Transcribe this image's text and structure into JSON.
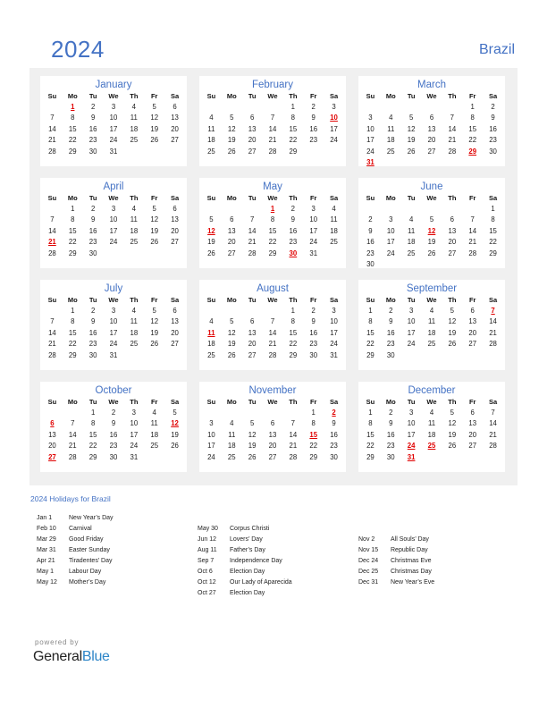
{
  "header": {
    "year": "2024",
    "country": "Brazil"
  },
  "weekday_labels": [
    "Su",
    "Mo",
    "Tu",
    "We",
    "Th",
    "Fr",
    "Sa"
  ],
  "colors": {
    "accent": "#4472c4",
    "holiday": "#e00000",
    "panel": "#f0f0f0",
    "brand_blue": "#2e86c8"
  },
  "months": [
    {
      "name": "January",
      "first_weekday": 1,
      "days": 31,
      "holidays": [
        1
      ]
    },
    {
      "name": "February",
      "first_weekday": 4,
      "days": 29,
      "holidays": [
        10
      ]
    },
    {
      "name": "March",
      "first_weekday": 5,
      "days": 31,
      "holidays": [
        29,
        31
      ]
    },
    {
      "name": "April",
      "first_weekday": 1,
      "days": 30,
      "holidays": [
        21
      ]
    },
    {
      "name": "May",
      "first_weekday": 3,
      "days": 31,
      "holidays": [
        1,
        12,
        30
      ]
    },
    {
      "name": "June",
      "first_weekday": 6,
      "days": 30,
      "holidays": [
        12
      ]
    },
    {
      "name": "July",
      "first_weekday": 1,
      "days": 31,
      "holidays": []
    },
    {
      "name": "August",
      "first_weekday": 4,
      "days": 31,
      "holidays": [
        11
      ]
    },
    {
      "name": "September",
      "first_weekday": 0,
      "days": 30,
      "holidays": [
        7
      ]
    },
    {
      "name": "October",
      "first_weekday": 2,
      "days": 31,
      "holidays": [
        6,
        12,
        27
      ]
    },
    {
      "name": "November",
      "first_weekday": 5,
      "days": 30,
      "holidays": [
        2,
        15
      ]
    },
    {
      "name": "December",
      "first_weekday": 0,
      "days": 31,
      "holidays": [
        24,
        25,
        31
      ]
    }
  ],
  "holidays_section": {
    "title": "2024 Holidays for Brazil",
    "columns": [
      [
        {
          "date": "Jan 1",
          "name": "New Year’s Day"
        },
        {
          "date": "Feb 10",
          "name": "Carnival"
        },
        {
          "date": "Mar 29",
          "name": "Good Friday"
        },
        {
          "date": "Mar 31",
          "name": "Easter Sunday"
        },
        {
          "date": "Apr 21",
          "name": "Tiradentes’ Day"
        },
        {
          "date": "May 1",
          "name": "Labour Day"
        },
        {
          "date": "May 12",
          "name": "Mother’s Day"
        }
      ],
      [
        {
          "date": "May 30",
          "name": "Corpus Christi"
        },
        {
          "date": "Jun 12",
          "name": "Lovers’ Day"
        },
        {
          "date": "Aug 11",
          "name": "Father’s Day"
        },
        {
          "date": "Sep 7",
          "name": "Independence Day"
        },
        {
          "date": "Oct 6",
          "name": "Election Day"
        },
        {
          "date": "Oct 12",
          "name": "Our Lady of Aparecida"
        },
        {
          "date": "Oct 27",
          "name": "Election Day"
        }
      ],
      [
        {
          "date": "Nov 2",
          "name": "All Souls’ Day"
        },
        {
          "date": "Nov 15",
          "name": "Republic Day"
        },
        {
          "date": "Dec 24",
          "name": "Christmas Eve"
        },
        {
          "date": "Dec 25",
          "name": "Christmas Day"
        },
        {
          "date": "Dec 31",
          "name": "New Year’s Eve"
        }
      ]
    ]
  },
  "footer": {
    "powered_by": "powered by",
    "brand_part1": "General",
    "brand_part2": "Blue"
  }
}
